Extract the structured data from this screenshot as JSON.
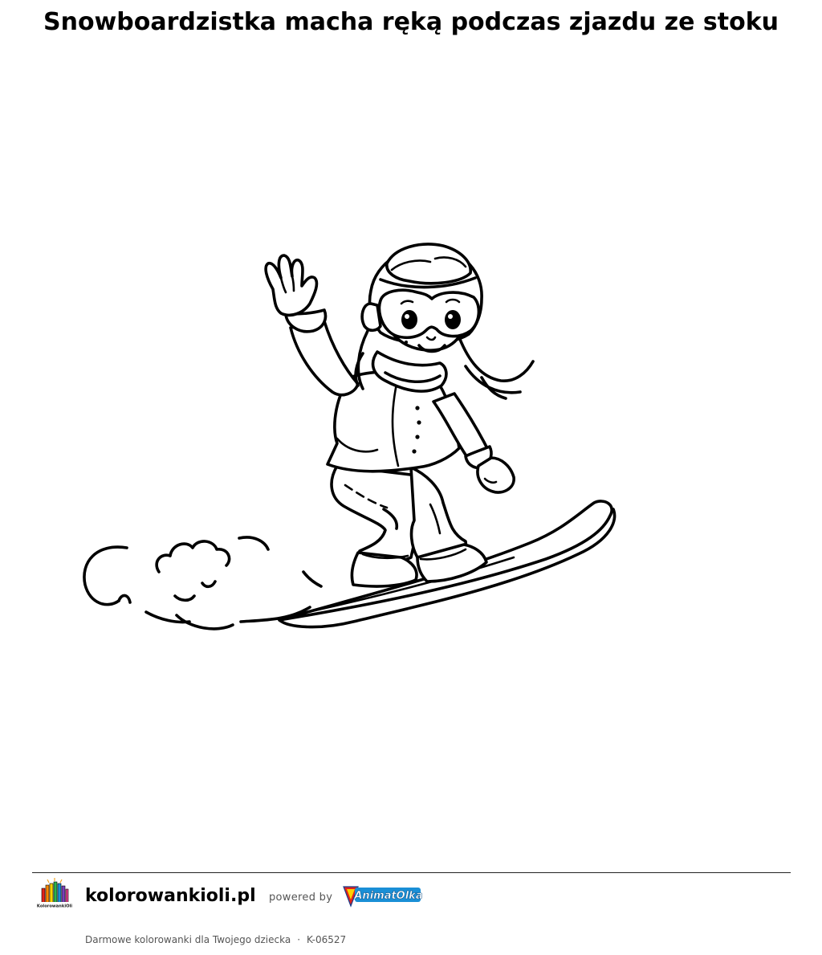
{
  "page": {
    "title": "Snowboardzistka macha ręką podczas zjazdu ze stoku"
  },
  "illustration": {
    "icon": "snowboarder-girl-waving-line-art"
  },
  "footer": {
    "site_name": "kolorowankioli.pl",
    "powered_by": "powered by",
    "partner_logo_text": "AnimatOlka",
    "site_logo_text": "KolorowankiOli",
    "tagline": "Darmowe kolorowanki dla Twojego dziecka",
    "separator": "·",
    "code": "K-06527"
  },
  "colors": {
    "rule": "#222222",
    "muted_text": "#555555",
    "partner_blue": "#1a8fd6",
    "partner_red": "#e2231a",
    "partner_yellow": "#ffd200"
  }
}
